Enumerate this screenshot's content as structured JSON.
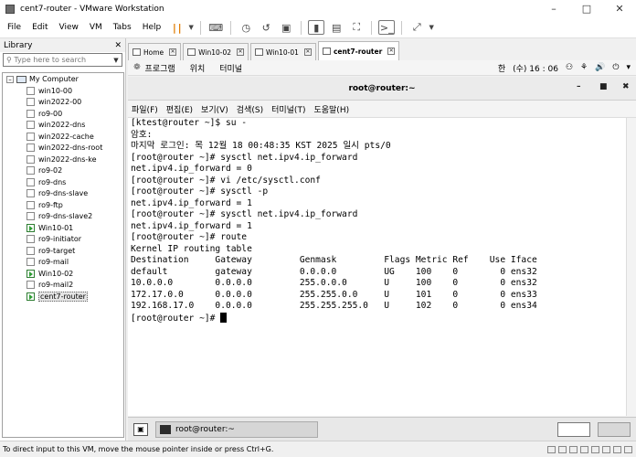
{
  "window": {
    "title": "cent7-router - VMware Workstation"
  },
  "menubar": {
    "items": [
      "File",
      "Edit",
      "View",
      "VM",
      "Tabs",
      "Help"
    ]
  },
  "library": {
    "title": "Library",
    "search_placeholder": "Type here to search",
    "root": "My Computer",
    "vms": [
      {
        "name": "win10-00",
        "running": false
      },
      {
        "name": "win2022-00",
        "running": false
      },
      {
        "name": "ro9-00",
        "running": false
      },
      {
        "name": "win2022-dns",
        "running": false
      },
      {
        "name": "win2022-cache",
        "running": false
      },
      {
        "name": "win2022-dns-root",
        "running": false
      },
      {
        "name": "win2022-dns-ke",
        "running": false
      },
      {
        "name": "ro9-02",
        "running": false
      },
      {
        "name": "ro9-dns",
        "running": false
      },
      {
        "name": "ro9-dns-slave",
        "running": false
      },
      {
        "name": "ro9-ftp",
        "running": false
      },
      {
        "name": "ro9-dns-slave2",
        "running": false
      },
      {
        "name": "Win10-01",
        "running": true
      },
      {
        "name": "ro9-initiator",
        "running": false
      },
      {
        "name": "ro9-target",
        "running": false
      },
      {
        "name": "ro9-mail",
        "running": false
      },
      {
        "name": "Win10-02",
        "running": true
      },
      {
        "name": "ro9-mail2",
        "running": false
      },
      {
        "name": "cent7-router",
        "running": true,
        "selected": true
      }
    ]
  },
  "tabs": [
    {
      "label": "Home",
      "active": false
    },
    {
      "label": "Win10-02",
      "active": false
    },
    {
      "label": "Win10-01",
      "active": false
    },
    {
      "label": "cent7-router",
      "active": true
    }
  ],
  "gnome": {
    "apps": "프로그램",
    "places": "위치",
    "terminal": "터미널",
    "input_lang": "한",
    "clock": "(수) 16 : 06"
  },
  "terminal": {
    "title": "root@router:~",
    "menu": [
      "파일(F)",
      "편집(E)",
      "보기(V)",
      "검색(S)",
      "터미널(T)",
      "도움말(H)"
    ],
    "lines": [
      "[ktest@router ~]$ su -",
      "암호:",
      "마지막 로그인: 목 12월 18 00:48:35 KST 2025 일시 pts/0",
      "[root@router ~]# sysctl net.ipv4.ip_forward",
      "net.ipv4.ip_forward = 0",
      "[root@router ~]# vi /etc/sysctl.conf",
      "[root@router ~]# sysctl -p",
      "net.ipv4.ip_forward = 1",
      "[root@router ~]# sysctl net.ipv4.ip_forward",
      "net.ipv4.ip_forward = 1",
      "[root@router ~]# route",
      "Kernel IP routing table",
      "Destination     Gateway         Genmask         Flags Metric Ref    Use Iface",
      "default         gateway         0.0.0.0         UG    100    0        0 ens32",
      "10.0.0.0        0.0.0.0         255.0.0.0       U     100    0        0 ens32",
      "172.17.0.0      0.0.0.0         255.255.0.0     U     101    0        0 ens33",
      "192.168.17.0    0.0.0.0         255.255.255.0   U     102    0        0 ens34"
    ],
    "prompt": "[root@router ~]# "
  },
  "taskbar": {
    "item": "root@router:~"
  },
  "statusbar": {
    "text": "To direct input to this VM, move the mouse pointer inside or press Ctrl+G."
  }
}
